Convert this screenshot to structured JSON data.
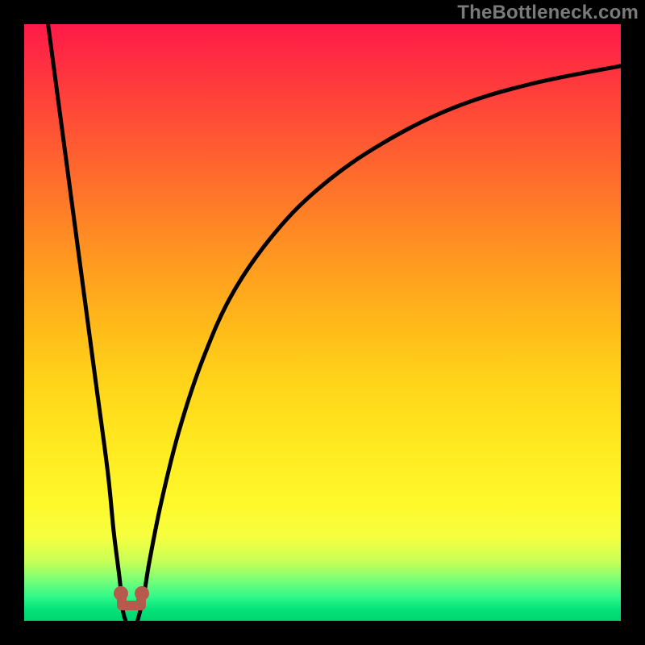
{
  "watermark": "TheBottleneck.com",
  "colors": {
    "background": "#000000",
    "curve": "#000000",
    "marker": "#b65a4e"
  },
  "chart_data": {
    "type": "line",
    "title": "",
    "xlabel": "",
    "ylabel": "",
    "xlim": [
      0,
      100
    ],
    "ylim": [
      0,
      100
    ],
    "grid": false,
    "series": [
      {
        "name": "left-branch",
        "x": [
          4,
          6,
          8,
          10,
          12,
          14,
          15,
          16,
          16.5,
          17
        ],
        "y": [
          100,
          85,
          70,
          55,
          40,
          25,
          15,
          7,
          2,
          0
        ]
      },
      {
        "name": "right-branch",
        "x": [
          19,
          20,
          21,
          23,
          26,
          30,
          35,
          42,
          50,
          60,
          72,
          85,
          100
        ],
        "y": [
          0,
          4,
          10,
          20,
          32,
          44,
          55,
          65,
          73,
          80,
          86,
          90,
          93
        ]
      }
    ],
    "background_gradient": {
      "direction": "vertical",
      "stops": [
        {
          "pos": 0,
          "color": "#ff1a48"
        },
        {
          "pos": 50,
          "color": "#ffb81a"
        },
        {
          "pos": 80,
          "color": "#fff82a"
        },
        {
          "pos": 100,
          "color": "#00d46e"
        }
      ]
    },
    "marker": {
      "shape": "u-shaped-dot-cluster",
      "x": 18,
      "y": 2,
      "color": "#b65a4e"
    }
  }
}
